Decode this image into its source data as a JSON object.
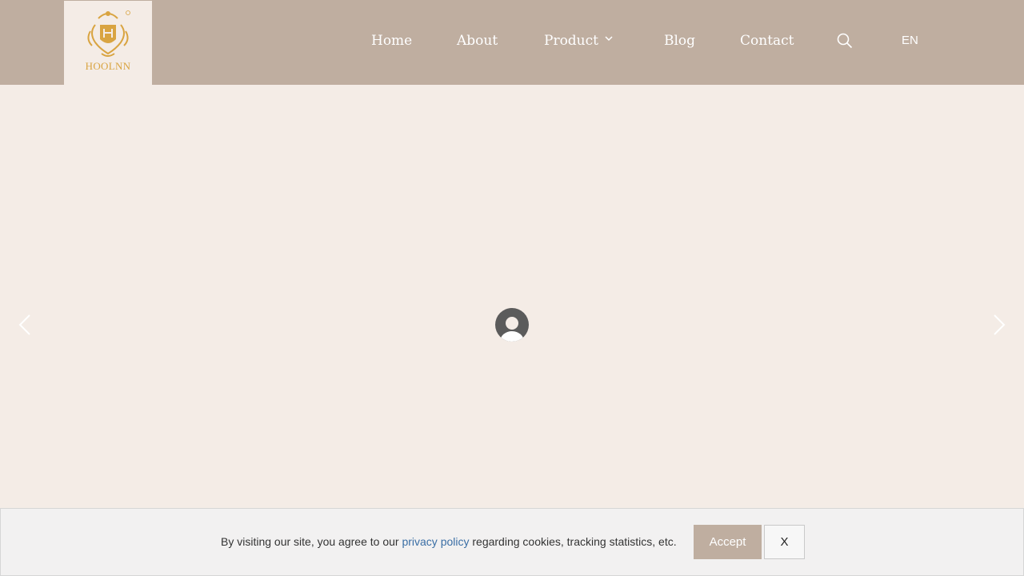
{
  "brand": {
    "logo_text": "HOOLNN"
  },
  "nav": {
    "items": [
      {
        "label": "Home"
      },
      {
        "label": "About"
      },
      {
        "label": "Product"
      },
      {
        "label": "Blog"
      },
      {
        "label": "Contact"
      }
    ],
    "language": "EN"
  },
  "icons": {
    "search": "search-icon",
    "dropdown": "chevron-down-icon",
    "prev": "chevron-left-icon",
    "next": "chevron-right-icon",
    "loading": "loading-avatar-icon"
  },
  "cookie": {
    "text_before": "By visiting our site, you agree to our ",
    "link": "privacy policy",
    "text_after": " regarding cookies, tracking statistics, etc.",
    "accept_label": "Accept",
    "close_label": "X"
  },
  "colors": {
    "header_bg": "#bfaea0",
    "page_bg": "#f4ece6",
    "logo_gold": "#d9a441",
    "link": "#3a6ea5"
  }
}
